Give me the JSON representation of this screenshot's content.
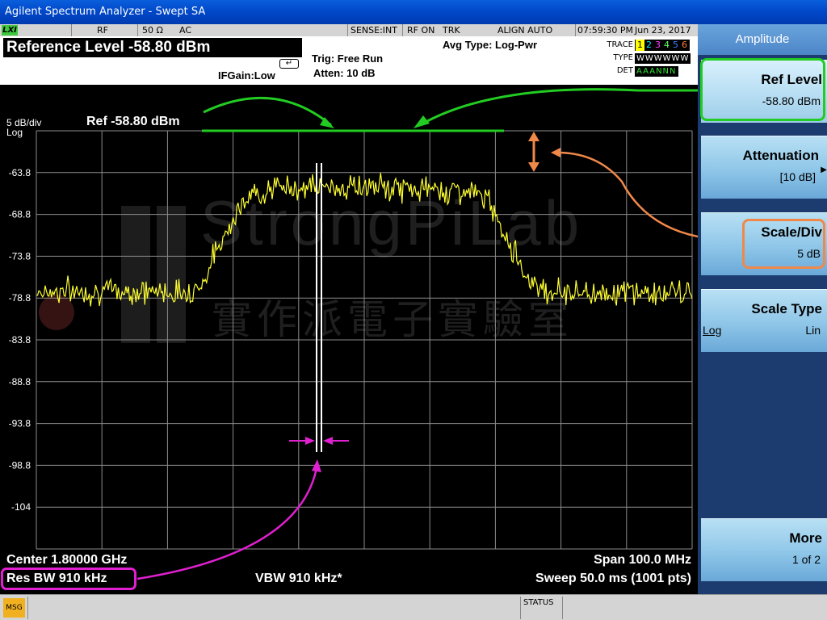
{
  "window": {
    "title": "Agilent Spectrum Analyzer - Swept SA"
  },
  "status_row": {
    "lxi": "LXI",
    "rf": "RF",
    "impedance": "50 Ω",
    "coupling": "AC",
    "sense": "SENSE:INT",
    "rf_on": "RF ON",
    "trk": "TRK",
    "align": "ALIGN AUTO",
    "time": "07:59:30 PM",
    "date": "Jun 23, 2017"
  },
  "header": {
    "ref_level": "Reference Level -58.80 dBm",
    "trig": "Trig: Free Run",
    "atten": "Atten: 10 dB",
    "ifgain": "IFGain:Low",
    "avg_type": "Avg Type: Log-Pwr",
    "trace_label": "TRACE",
    "type_label": "TYPE",
    "det_label": "DET",
    "trace_numbers": [
      "1",
      "2",
      "3",
      "4",
      "5",
      "6"
    ],
    "trace_colors": [
      "#ffff00",
      "#00e5ff",
      "#ff40ff",
      "#60ff60",
      "#4080ff",
      "#ff8040"
    ],
    "trace_types": "WWWWWW",
    "trace_dets": "AAANNN"
  },
  "graph": {
    "scale_div": "5 dB/div",
    "scale_type": "Log",
    "ref_text": "Ref -58.80 dBm",
    "y_ticks": [
      "-63.8",
      "-68.8",
      "-73.8",
      "-78.8",
      "-83.8",
      "-88.8",
      "-93.8",
      "-98.8",
      "-104"
    ],
    "watermark_en": "StrongPiLab",
    "watermark_zh": "實作派電子實驗室",
    "center": "Center 1.80000 GHz",
    "res_bw": "Res BW 910 kHz",
    "vbw": "VBW 910 kHz*",
    "span": "Span 100.0 MHz",
    "sweep": "Sweep  50.0 ms (1001 pts)",
    "trace_color": "#ffff30",
    "annotation_colors": {
      "ref": "#22cc22",
      "scale": "#f0884a",
      "rbw": "#e020d0"
    }
  },
  "chart_data": {
    "type": "line",
    "ylabel": "",
    "xlabel": "",
    "y_unit": "dBm",
    "ylim": [
      -108.8,
      -58.8
    ],
    "xlim_mhz": [
      1750,
      1850
    ],
    "grid": true,
    "series": [
      {
        "x_mhz": [
          1750,
          1760,
          1770,
          1772,
          1775,
          1777,
          1780,
          1783,
          1785,
          1790,
          1795,
          1800,
          1805,
          1810,
          1815,
          1818,
          1820,
          1822,
          1825,
          1828,
          1830,
          1835,
          1840,
          1845,
          1850
        ],
        "y_dbm": [
          -78,
          -78,
          -78,
          -78.2,
          -77.5,
          -74,
          -69,
          -66.5,
          -65.8,
          -65.5,
          -65.6,
          -65.5,
          -65.7,
          -65.8,
          -66,
          -66.5,
          -68.5,
          -72,
          -76.5,
          -78,
          -78,
          -78.2,
          -78,
          -78.3,
          -78.2
        ]
      }
    ]
  },
  "softkeys": {
    "title": "Amplitude",
    "ref_level": {
      "label": "Ref Level",
      "value": "-58.80 dBm"
    },
    "attenuation": {
      "label": "Attenuation",
      "value": "[10 dB]",
      "arrow": "▶"
    },
    "scale_div": {
      "label": "Scale/Div",
      "value": "5 dB"
    },
    "scale_type": {
      "label": "Scale Type",
      "left": "Log",
      "right": "Lin"
    },
    "more": {
      "label": "More",
      "value": "1 of 2"
    }
  },
  "bottom_bar": {
    "msg": "MSG",
    "status": "STATUS"
  }
}
